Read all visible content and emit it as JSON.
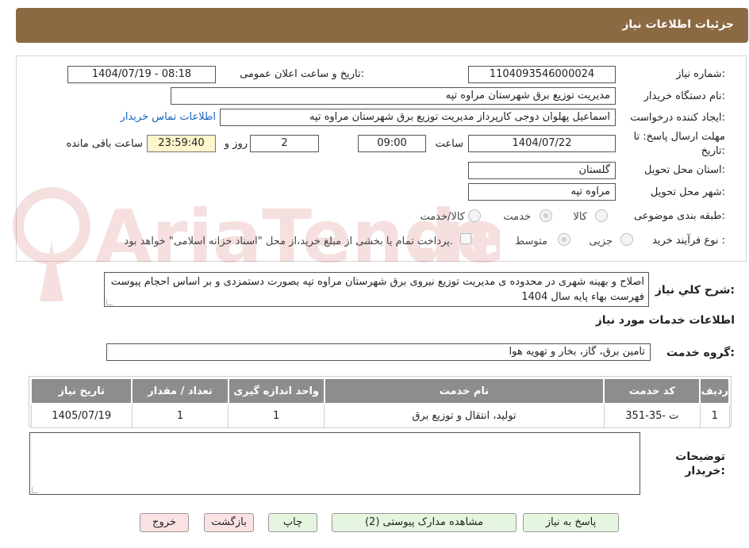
{
  "header": {
    "title": "جزئیات اطلاعات نیاز"
  },
  "form": {
    "need_number_label": "شماره نیاز:",
    "need_number": "1104093546000024",
    "announce_label": "تاریخ و ساعت اعلان عمومی:",
    "announce_value": "1404/07/19 - 08:18",
    "buyer_org_label": "نام دستگاه خریدار:",
    "buyer_org": "مدیریت توزیع برق شهرستان مراوه تپه",
    "requester_label": "ایجاد کننده درخواست:",
    "requester": "اسماعیل پهلوان دوجی کارپرداز مدیریت توزیع برق شهرستان مراوه تپه",
    "contact_link": "اطلاعات تماس خریدار",
    "deadline_label_1": "مهلت ارسال پاسخ: تا",
    "deadline_label_2": "تاریخ:",
    "deadline_date": "1404/07/22",
    "time_label": "ساعت",
    "deadline_time": "09:00",
    "days_value": "2",
    "days_label": "روز و",
    "remaining_time": "23:59:40",
    "remaining_label": "ساعت باقی مانده",
    "province_label": "استان محل تحویل:",
    "province": "گلستان",
    "city_label": "شهر محل تحویل:",
    "city": "مراوه تپه",
    "category_label": "طبقه بندی موضوعی:",
    "category_options": [
      "کالا",
      "خدمت",
      "کالا/خدمت"
    ],
    "process_label": "نوع فرآیند خرید :",
    "process_options": [
      "جزیی",
      "متوسط"
    ],
    "payment_note": "پرداخت تمام یا بخشی از مبلغ خرید،از محل \"اسناد خزانه اسلامی\" خواهد بود."
  },
  "description": {
    "label": "شرح کلي نياز:",
    "text": "اصلاح و بهینه شهری در محدوده ی مدیریت توزیع نیروی برق شهرستان مراوه تپه بصورت دستمزدی و بر اساس احجام پیوست فهرست بهاء پایه سال 1404"
  },
  "services": {
    "section_title": "اطلاعات خدمات مورد نیاز",
    "group_label": "گروه خدمت:",
    "group_value": "تامین برق، گاز، بخار و تهویه هوا",
    "columns": [
      "ردیف",
      "کد خدمت",
      "نام خدمت",
      "واحد اندازه گیری",
      "تعداد / مقدار",
      "تاریخ نیاز"
    ],
    "rows": [
      [
        "1",
        "ت -35-351",
        "تولید، انتقال و توزیع برق",
        "1",
        "1",
        "1405/07/19"
      ]
    ]
  },
  "notes": {
    "label_1": "توضیحات",
    "label_2": "خریدار:"
  },
  "buttons": {
    "reply": "پاسخ به نیاز",
    "attachments": "مشاهده مدارک پیوستی (2)",
    "print": "چاپ",
    "back": "بازگشت",
    "exit": "خروج"
  },
  "colors": {
    "header_bg": "#8b6a43",
    "table_header_bg": "#8d8d8d",
    "time_bg": "#fff5cc",
    "link": "#1565c0"
  }
}
